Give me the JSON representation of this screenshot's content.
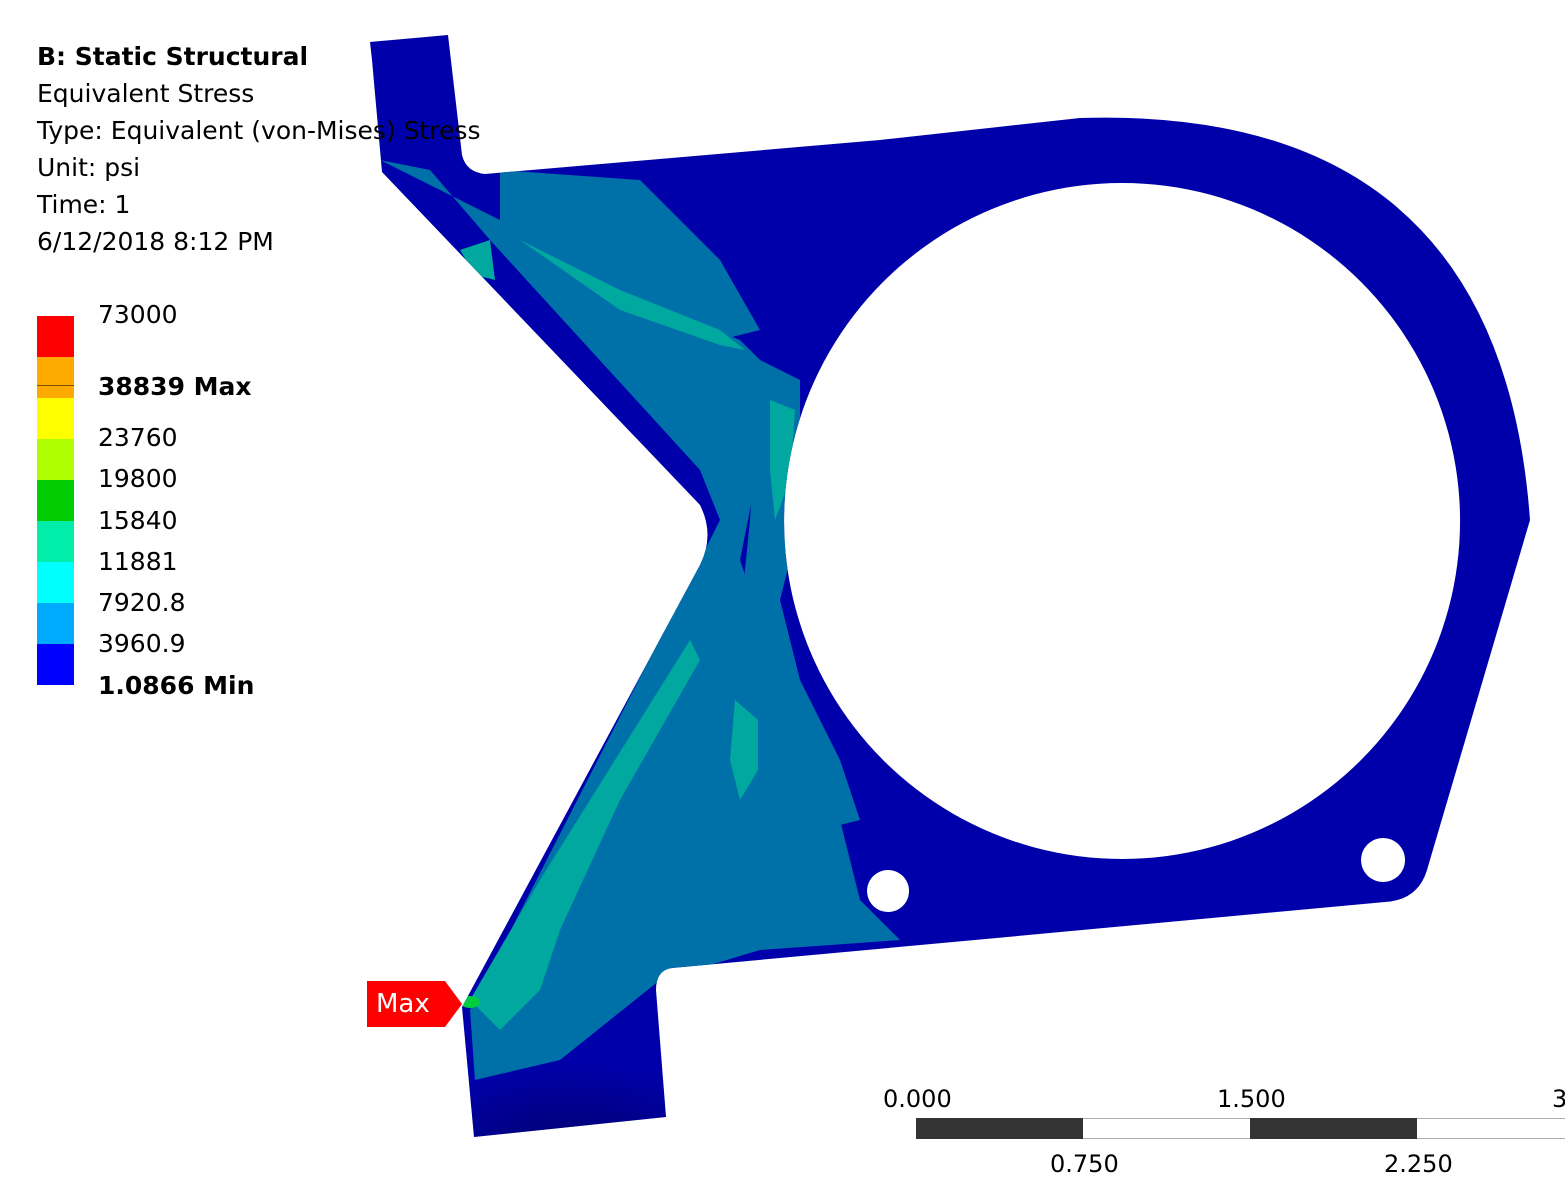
{
  "header": {
    "analysis_title": "B: Static Structural",
    "result_name": "Equivalent Stress",
    "result_type": "Type: Equivalent (von-Mises) Stress",
    "unit": "Unit: psi",
    "time": "Time: 1",
    "timestamp": "6/12/2018 8:12 PM"
  },
  "legend": {
    "labels": [
      "73000",
      "38839 Max",
      "23760",
      "19800",
      "15840",
      "11881",
      "7920.8",
      "3960.9",
      "1.0866 Min"
    ],
    "colors": [
      "#ff0000",
      "#ffaa00",
      "#ffff00",
      "#b0ff00",
      "#00cc00",
      "#00eeaa",
      "#00ffff",
      "#00aaff",
      "#0000ff"
    ]
  },
  "probe": {
    "label": "Max",
    "color": "#ff0000"
  },
  "scale_bar": {
    "top_ticks": [
      "0.000",
      "1.500",
      "3"
    ],
    "bottom_ticks": [
      "0.750",
      "2.250"
    ]
  },
  "model_colors": {
    "low": "#0000aa",
    "mid": "#0070a8",
    "high": "#00a8a0",
    "peak": "#00cc40"
  }
}
